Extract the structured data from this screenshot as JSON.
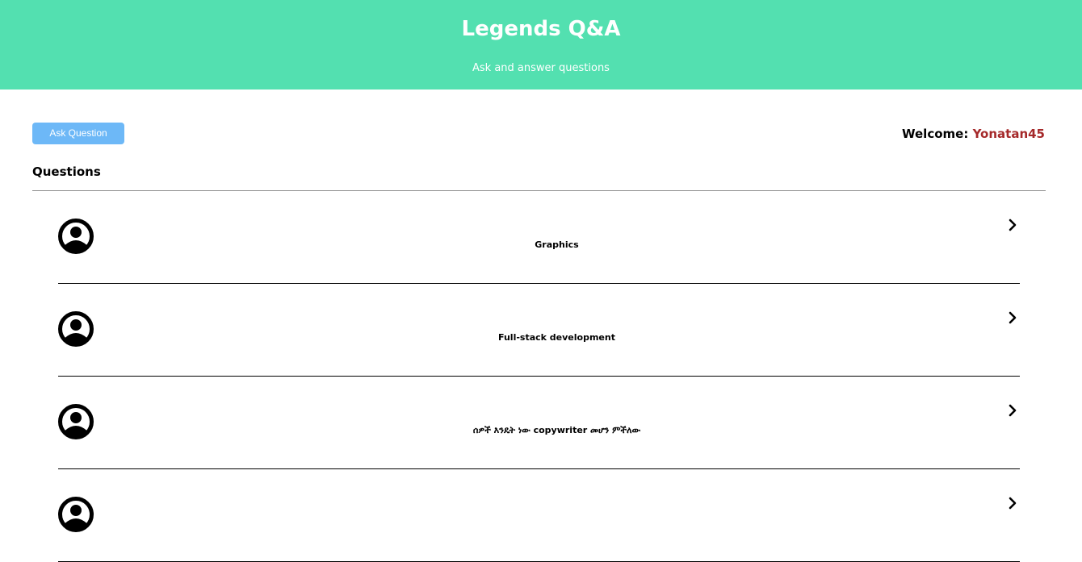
{
  "header": {
    "title": "Legends Q&A",
    "subtitle": "Ask and answer questions"
  },
  "toolbar": {
    "ask_label": "Ask Question",
    "welcome_prefix": "Welcome:",
    "username": "Yonatan45",
    "username_color": "#a5292a"
  },
  "questions": {
    "heading": "Questions",
    "items": [
      {
        "title": "Graphics",
        "avatar_icon": "user-avatar-icon",
        "open_icon": "chevron-right-icon"
      },
      {
        "title": "Full-stack development",
        "avatar_icon": "user-avatar-icon",
        "open_icon": "chevron-right-icon"
      },
      {
        "title": "ሰዎች እንዴት ነው copywriter መሆን ምችለው",
        "avatar_icon": "user-avatar-icon",
        "open_icon": "chevron-right-icon"
      },
      {
        "title": "",
        "avatar_icon": "user-avatar-icon",
        "open_icon": "chevron-right-icon"
      }
    ]
  },
  "colors": {
    "header_bg": "#53e0b0",
    "button_bg": "#6db8f7"
  }
}
